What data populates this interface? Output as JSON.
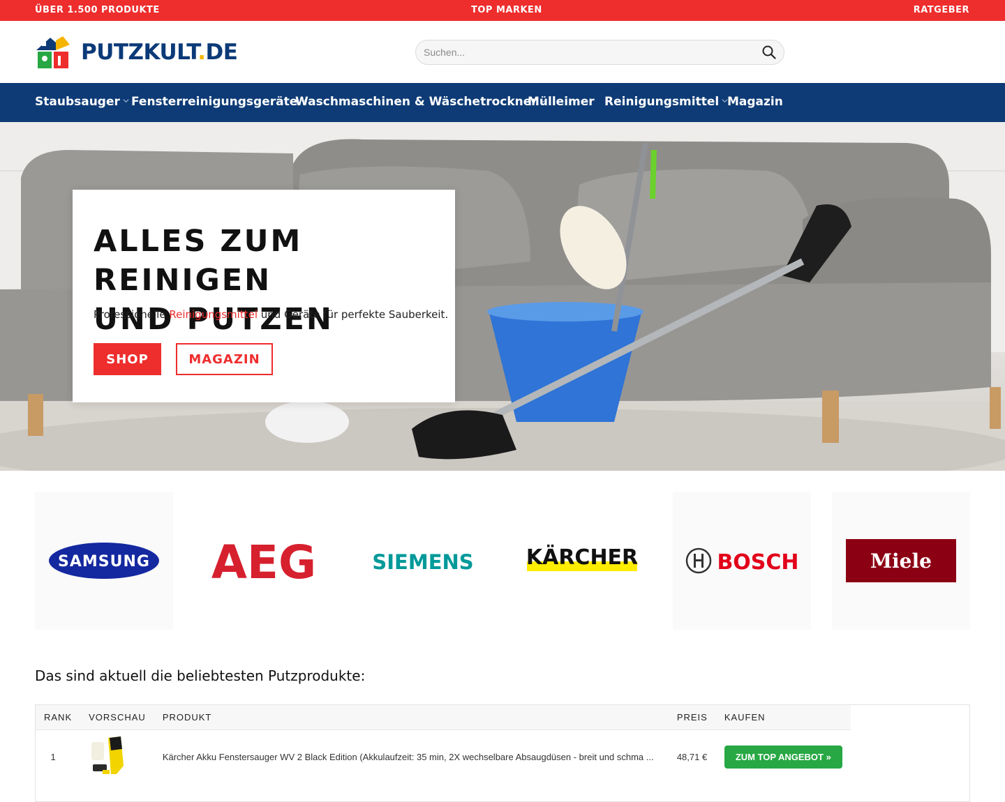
{
  "topbar": {
    "left": "ÜBER 1.500 PRODUKTE",
    "center": "TOP MARKEN",
    "right": "RATGEBER"
  },
  "header": {
    "logo_text": "PUTZKULT",
    "logo_dot": ".",
    "logo_tld": "DE",
    "search_placeholder": "Suchen...",
    "search_icon": "search-icon"
  },
  "nav": {
    "items": [
      {
        "label": "Staubsauger",
        "dropdown": true
      },
      {
        "label": "Fensterreinigungsgeräte",
        "dropdown": true
      },
      {
        "label": "Waschmaschinen & Wäschetrockner",
        "dropdown": true
      },
      {
        "label": "Mülleimer",
        "dropdown": false
      },
      {
        "label": "Reinigungsmittel",
        "dropdown": true
      },
      {
        "label": "Magazin",
        "dropdown": false
      }
    ]
  },
  "hero": {
    "title_line1": "ALLES ZUM REINIGEN",
    "title_line2": "UND PUTZEN",
    "sub_before": "Professionelle ",
    "sub_link": "Reinigungsmittel",
    "sub_after": " und Geräte für perfekte Sauberkeit.",
    "btn_shop": "SHOP",
    "btn_magazin": "MAGAZIN"
  },
  "brands": [
    {
      "name": "SAMSUNG",
      "color": "#1428a0"
    },
    {
      "name": "AEG",
      "color": "#d6202e"
    },
    {
      "name": "SIEMENS",
      "color": "#009999"
    },
    {
      "name": "KÄRCHER",
      "color": "#111111",
      "accent": "#ffed00"
    },
    {
      "name": "BOSCH",
      "color": "#e2001a"
    },
    {
      "name": "Miele",
      "color": "#8c0014"
    }
  ],
  "section_title": "Das sind aktuell die beliebtesten Putzprodukte:",
  "table": {
    "headers": [
      "Rank",
      "Vorschau",
      "Produkt",
      "Preis",
      "Kaufen"
    ],
    "rows": [
      {
        "rank": "1",
        "product": "Kärcher Akku Fenstersauger WV 2 Black Edition (Akkulaufzeit: 35 min, 2X wechselbare Absaugdüsen - breit und schma ...",
        "price": "48,71 €",
        "buy": "ZUM TOP ANGEBOT »"
      }
    ]
  },
  "colors": {
    "accent_red": "#ee2d2d",
    "nav_blue": "#0e3b76",
    "buy_green": "#27a844"
  }
}
